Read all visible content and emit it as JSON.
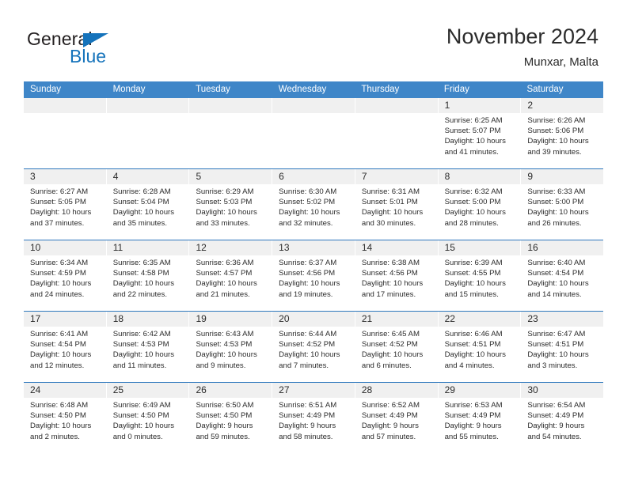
{
  "brand": {
    "name_part1": "General",
    "name_part2": "Blue",
    "triangle_color": "#1573bb",
    "text_color": "#231f20"
  },
  "header": {
    "title": "November 2024",
    "subtitle": "Munxar, Malta"
  },
  "theme": {
    "header_bar_color": "#3f86c8",
    "row_divider_color": "#2f78bd",
    "day_head_color": "#f0f0f0",
    "text_color": "#2b2b2b",
    "page_background": "#ffffff"
  },
  "weekdays": [
    "Sunday",
    "Monday",
    "Tuesday",
    "Wednesday",
    "Thursday",
    "Friday",
    "Saturday"
  ],
  "labels": {
    "sunrise_prefix": "Sunrise:",
    "sunset_prefix": "Sunset:",
    "daylight_prefix": "Daylight:"
  },
  "weeks": [
    [
      {
        "empty": true
      },
      {
        "empty": true
      },
      {
        "empty": true
      },
      {
        "empty": true
      },
      {
        "empty": true
      },
      {
        "day": "1",
        "sunrise": "Sunrise: 6:25 AM",
        "sunset": "Sunset: 5:07 PM",
        "daylight_line1": "Daylight: 10 hours",
        "daylight_line2": "and 41 minutes."
      },
      {
        "day": "2",
        "sunrise": "Sunrise: 6:26 AM",
        "sunset": "Sunset: 5:06 PM",
        "daylight_line1": "Daylight: 10 hours",
        "daylight_line2": "and 39 minutes."
      }
    ],
    [
      {
        "day": "3",
        "sunrise": "Sunrise: 6:27 AM",
        "sunset": "Sunset: 5:05 PM",
        "daylight_line1": "Daylight: 10 hours",
        "daylight_line2": "and 37 minutes."
      },
      {
        "day": "4",
        "sunrise": "Sunrise: 6:28 AM",
        "sunset": "Sunset: 5:04 PM",
        "daylight_line1": "Daylight: 10 hours",
        "daylight_line2": "and 35 minutes."
      },
      {
        "day": "5",
        "sunrise": "Sunrise: 6:29 AM",
        "sunset": "Sunset: 5:03 PM",
        "daylight_line1": "Daylight: 10 hours",
        "daylight_line2": "and 33 minutes."
      },
      {
        "day": "6",
        "sunrise": "Sunrise: 6:30 AM",
        "sunset": "Sunset: 5:02 PM",
        "daylight_line1": "Daylight: 10 hours",
        "daylight_line2": "and 32 minutes."
      },
      {
        "day": "7",
        "sunrise": "Sunrise: 6:31 AM",
        "sunset": "Sunset: 5:01 PM",
        "daylight_line1": "Daylight: 10 hours",
        "daylight_line2": "and 30 minutes."
      },
      {
        "day": "8",
        "sunrise": "Sunrise: 6:32 AM",
        "sunset": "Sunset: 5:00 PM",
        "daylight_line1": "Daylight: 10 hours",
        "daylight_line2": "and 28 minutes."
      },
      {
        "day": "9",
        "sunrise": "Sunrise: 6:33 AM",
        "sunset": "Sunset: 5:00 PM",
        "daylight_line1": "Daylight: 10 hours",
        "daylight_line2": "and 26 minutes."
      }
    ],
    [
      {
        "day": "10",
        "sunrise": "Sunrise: 6:34 AM",
        "sunset": "Sunset: 4:59 PM",
        "daylight_line1": "Daylight: 10 hours",
        "daylight_line2": "and 24 minutes."
      },
      {
        "day": "11",
        "sunrise": "Sunrise: 6:35 AM",
        "sunset": "Sunset: 4:58 PM",
        "daylight_line1": "Daylight: 10 hours",
        "daylight_line2": "and 22 minutes."
      },
      {
        "day": "12",
        "sunrise": "Sunrise: 6:36 AM",
        "sunset": "Sunset: 4:57 PM",
        "daylight_line1": "Daylight: 10 hours",
        "daylight_line2": "and 21 minutes."
      },
      {
        "day": "13",
        "sunrise": "Sunrise: 6:37 AM",
        "sunset": "Sunset: 4:56 PM",
        "daylight_line1": "Daylight: 10 hours",
        "daylight_line2": "and 19 minutes."
      },
      {
        "day": "14",
        "sunrise": "Sunrise: 6:38 AM",
        "sunset": "Sunset: 4:56 PM",
        "daylight_line1": "Daylight: 10 hours",
        "daylight_line2": "and 17 minutes."
      },
      {
        "day": "15",
        "sunrise": "Sunrise: 6:39 AM",
        "sunset": "Sunset: 4:55 PM",
        "daylight_line1": "Daylight: 10 hours",
        "daylight_line2": "and 15 minutes."
      },
      {
        "day": "16",
        "sunrise": "Sunrise: 6:40 AM",
        "sunset": "Sunset: 4:54 PM",
        "daylight_line1": "Daylight: 10 hours",
        "daylight_line2": "and 14 minutes."
      }
    ],
    [
      {
        "day": "17",
        "sunrise": "Sunrise: 6:41 AM",
        "sunset": "Sunset: 4:54 PM",
        "daylight_line1": "Daylight: 10 hours",
        "daylight_line2": "and 12 minutes."
      },
      {
        "day": "18",
        "sunrise": "Sunrise: 6:42 AM",
        "sunset": "Sunset: 4:53 PM",
        "daylight_line1": "Daylight: 10 hours",
        "daylight_line2": "and 11 minutes."
      },
      {
        "day": "19",
        "sunrise": "Sunrise: 6:43 AM",
        "sunset": "Sunset: 4:53 PM",
        "daylight_line1": "Daylight: 10 hours",
        "daylight_line2": "and 9 minutes."
      },
      {
        "day": "20",
        "sunrise": "Sunrise: 6:44 AM",
        "sunset": "Sunset: 4:52 PM",
        "daylight_line1": "Daylight: 10 hours",
        "daylight_line2": "and 7 minutes."
      },
      {
        "day": "21",
        "sunrise": "Sunrise: 6:45 AM",
        "sunset": "Sunset: 4:52 PM",
        "daylight_line1": "Daylight: 10 hours",
        "daylight_line2": "and 6 minutes."
      },
      {
        "day": "22",
        "sunrise": "Sunrise: 6:46 AM",
        "sunset": "Sunset: 4:51 PM",
        "daylight_line1": "Daylight: 10 hours",
        "daylight_line2": "and 4 minutes."
      },
      {
        "day": "23",
        "sunrise": "Sunrise: 6:47 AM",
        "sunset": "Sunset: 4:51 PM",
        "daylight_line1": "Daylight: 10 hours",
        "daylight_line2": "and 3 minutes."
      }
    ],
    [
      {
        "day": "24",
        "sunrise": "Sunrise: 6:48 AM",
        "sunset": "Sunset: 4:50 PM",
        "daylight_line1": "Daylight: 10 hours",
        "daylight_line2": "and 2 minutes."
      },
      {
        "day": "25",
        "sunrise": "Sunrise: 6:49 AM",
        "sunset": "Sunset: 4:50 PM",
        "daylight_line1": "Daylight: 10 hours",
        "daylight_line2": "and 0 minutes."
      },
      {
        "day": "26",
        "sunrise": "Sunrise: 6:50 AM",
        "sunset": "Sunset: 4:50 PM",
        "daylight_line1": "Daylight: 9 hours",
        "daylight_line2": "and 59 minutes."
      },
      {
        "day": "27",
        "sunrise": "Sunrise: 6:51 AM",
        "sunset": "Sunset: 4:49 PM",
        "daylight_line1": "Daylight: 9 hours",
        "daylight_line2": "and 58 minutes."
      },
      {
        "day": "28",
        "sunrise": "Sunrise: 6:52 AM",
        "sunset": "Sunset: 4:49 PM",
        "daylight_line1": "Daylight: 9 hours",
        "daylight_line2": "and 57 minutes."
      },
      {
        "day": "29",
        "sunrise": "Sunrise: 6:53 AM",
        "sunset": "Sunset: 4:49 PM",
        "daylight_line1": "Daylight: 9 hours",
        "daylight_line2": "and 55 minutes."
      },
      {
        "day": "30",
        "sunrise": "Sunrise: 6:54 AM",
        "sunset": "Sunset: 4:49 PM",
        "daylight_line1": "Daylight: 9 hours",
        "daylight_line2": "and 54 minutes."
      }
    ]
  ]
}
